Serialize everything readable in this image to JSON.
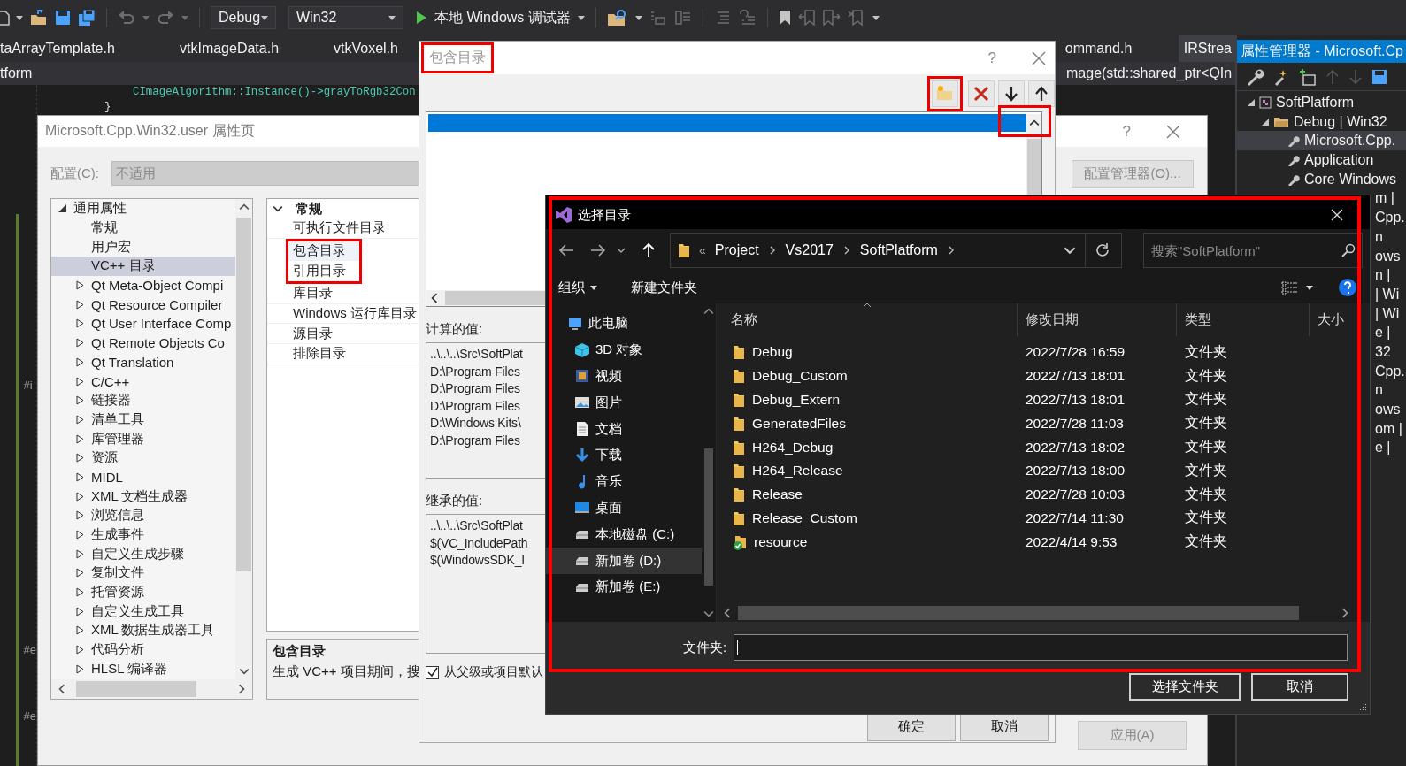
{
  "toolbar": {
    "configuration": "Debug",
    "platform": "Win32",
    "debugger": "本地 Windows 调试器"
  },
  "editor": {
    "tab_groups": [
      {
        "tabs": [
          {
            "label": "taArrayTemplate.h",
            "selected": false
          },
          {
            "label": "vtkImageData.h",
            "selected": false
          },
          {
            "label": "vtkVoxel.h",
            "selected": false
          }
        ]
      },
      {
        "tabs": [
          {
            "label": "ommand.h",
            "selected": false
          },
          {
            "label": "IRStrea",
            "selected": true
          }
        ]
      }
    ],
    "nav_bar": {
      "scope": "tform",
      "member": "mage(std::shared_ptr<QIn"
    },
    "code_lines": [
      "CImageAlgorithm::Instance()->grayToRgb32Con",
      "}"
    ],
    "gutter_marks": [
      "#i",
      "#e",
      "#e"
    ]
  },
  "property_manager": {
    "title": "属性管理器 - Microsoft.Cp",
    "tree": [
      {
        "label": "SoftPlatform",
        "kind": "project",
        "expanded": true,
        "selected": false,
        "children": [
          {
            "label": "Debug | Win32",
            "kind": "config",
            "expanded": true,
            "selected": false,
            "children": [
              {
                "label": "Microsoft.Cpp.",
                "kind": "sheet",
                "selected": true
              },
              {
                "label": "Application",
                "kind": "sheet",
                "selected": false
              },
              {
                "label": "Core Windows",
                "kind": "sheet",
                "selected": false
              }
            ]
          }
        ]
      }
    ],
    "clipped_rows": [
      "m |",
      "Cpp.",
      "n",
      "ows",
      "n |",
      "| Wi",
      "| Wi",
      "e |",
      "32",
      "Cpp.",
      "n",
      "ows",
      "om |",
      "e |"
    ]
  },
  "property_dialog": {
    "title": "Microsoft.Cpp.Win32.user 属性页",
    "help_button": "?",
    "configuration_label": "配置(C):",
    "configuration_value": "不适用",
    "manager_button": "配置管理器(O)...",
    "apply_button": "应用(A)",
    "tree": [
      {
        "label": "通用属性",
        "kind": "folder",
        "expanded": true,
        "selected": false,
        "children": [
          {
            "label": "常规",
            "kind": "leaf",
            "selected": false
          },
          {
            "label": "用户宏",
            "kind": "leaf",
            "selected": false
          },
          {
            "label": "VC++ 目录",
            "kind": "leaf",
            "selected": true
          },
          {
            "label": "Qt Meta-Object Compi",
            "kind": "folder",
            "expanded": false,
            "selected": false
          },
          {
            "label": "Qt Resource Compiler",
            "kind": "folder",
            "expanded": false,
            "selected": false
          },
          {
            "label": "Qt User Interface Comp",
            "kind": "folder",
            "expanded": false,
            "selected": false
          },
          {
            "label": "Qt Remote Objects Co",
            "kind": "folder",
            "expanded": false,
            "selected": false
          },
          {
            "label": "Qt Translation",
            "kind": "folder",
            "expanded": false,
            "selected": false
          },
          {
            "label": "C/C++",
            "kind": "folder",
            "expanded": false,
            "selected": false
          },
          {
            "label": "链接器",
            "kind": "folder",
            "expanded": false,
            "selected": false
          },
          {
            "label": "清单工具",
            "kind": "folder",
            "expanded": false,
            "selected": false
          },
          {
            "label": "库管理器",
            "kind": "folder",
            "expanded": false,
            "selected": false
          },
          {
            "label": "资源",
            "kind": "folder",
            "expanded": false,
            "selected": false
          },
          {
            "label": "MIDL",
            "kind": "folder",
            "expanded": false,
            "selected": false
          },
          {
            "label": "XML 文档生成器",
            "kind": "folder",
            "expanded": false,
            "selected": false
          },
          {
            "label": "浏览信息",
            "kind": "folder",
            "expanded": false,
            "selected": false
          },
          {
            "label": "生成事件",
            "kind": "folder",
            "expanded": false,
            "selected": false
          },
          {
            "label": "自定义生成步骤",
            "kind": "folder",
            "expanded": false,
            "selected": false
          },
          {
            "label": "复制文件",
            "kind": "folder",
            "expanded": false,
            "selected": false
          },
          {
            "label": "托管资源",
            "kind": "folder",
            "expanded": false,
            "selected": false
          },
          {
            "label": "自定义生成工具",
            "kind": "folder",
            "expanded": false,
            "selected": false
          },
          {
            "label": "XML 数据生成器工具",
            "kind": "folder",
            "expanded": false,
            "selected": false
          },
          {
            "label": "代码分析",
            "kind": "folder",
            "expanded": false,
            "selected": false
          },
          {
            "label": "HLSL 编译器",
            "kind": "folder",
            "expanded": false,
            "selected": false
          }
        ]
      }
    ],
    "section": {
      "label": "常规",
      "expanded": true,
      "items": [
        {
          "label": "可执行文件目录",
          "selected": false,
          "highlighted": false
        },
        {
          "label": "包含目录",
          "selected": true,
          "highlighted": true
        },
        {
          "label": "引用目录",
          "selected": false,
          "highlighted": true
        },
        {
          "label": "库目录",
          "selected": false,
          "highlighted": false
        },
        {
          "label": "Windows 运行库目录",
          "selected": false,
          "highlighted": false
        },
        {
          "label": "源目录",
          "selected": false,
          "highlighted": false
        },
        {
          "label": "排除目录",
          "selected": false,
          "highlighted": false
        }
      ]
    },
    "description": {
      "title": "包含目录",
      "text": "生成 VC++ 项目期间，搜"
    }
  },
  "include_dialog": {
    "title": "包含目录",
    "title_highlighted": true,
    "help_button": "?",
    "tools": [
      {
        "kind": "new-folder",
        "highlighted": true
      },
      {
        "kind": "delete",
        "highlighted": false
      },
      {
        "kind": "move-down",
        "highlighted": false
      },
      {
        "kind": "move-up",
        "highlighted": false
      }
    ],
    "rows": [
      {
        "selected": true
      }
    ],
    "scroll_highlighted": true,
    "computed_label": "计算的值:",
    "computed_values": [
      "..\\..\\..\\Src\\SoftPlat",
      "D:\\Program Files",
      "D:\\Program Files",
      "D:\\Program Files",
      "D:\\Windows Kits\\",
      "D:\\Program Files"
    ],
    "inherited_label": "继承的值:",
    "inherited_values": [
      "..\\..\\..\\Src\\SoftPlat",
      "$(VC_IncludePath",
      "$(WindowsSDK_I"
    ],
    "inherit_option": {
      "label": "从父级或项目默认",
      "checked": true
    },
    "buttons": [
      "确定",
      "取消"
    ]
  },
  "folder_dialog": {
    "title": "选择目录",
    "highlighted": true,
    "overflow": "«",
    "path": [
      "Project",
      "Vs2017",
      "SoftPlatform"
    ],
    "search_placeholder": "搜索\"SoftPlatform\"",
    "organize": "组织",
    "new_folder": "新建文件夹",
    "nav_items": [
      {
        "label": "此电脑",
        "kind": "pc",
        "selected": false,
        "children": [
          {
            "label": "3D 对象",
            "kind": "objects",
            "selected": false
          },
          {
            "label": "视频",
            "kind": "videos",
            "selected": false
          },
          {
            "label": "图片",
            "kind": "pictures",
            "selected": false
          },
          {
            "label": "文档",
            "kind": "documents",
            "selected": false
          },
          {
            "label": "下载",
            "kind": "downloads",
            "selected": false
          },
          {
            "label": "音乐",
            "kind": "music",
            "selected": false
          },
          {
            "label": "桌面",
            "kind": "desktop",
            "selected": false
          },
          {
            "label": "本地磁盘 (C:)",
            "kind": "drive",
            "selected": false
          },
          {
            "label": "新加卷 (D:)",
            "kind": "drive",
            "selected": true
          },
          {
            "label": "新加卷 (E:)",
            "kind": "drive",
            "selected": false
          }
        ]
      }
    ],
    "columns": [
      "名称",
      "修改日期",
      "类型",
      "大小"
    ],
    "files": [
      {
        "name": "Debug",
        "kind": "folder",
        "modified": "2022/7/28 16:59",
        "type": "文件夹"
      },
      {
        "name": "Debug_Custom",
        "kind": "folder",
        "modified": "2022/7/13 18:01",
        "type": "文件夹"
      },
      {
        "name": "Debug_Extern",
        "kind": "folder",
        "modified": "2022/7/13 18:01",
        "type": "文件夹"
      },
      {
        "name": "GeneratedFiles",
        "kind": "folder",
        "modified": "2022/7/28 11:03",
        "type": "文件夹"
      },
      {
        "name": "H264_Debug",
        "kind": "folder",
        "modified": "2022/7/13 18:02",
        "type": "文件夹"
      },
      {
        "name": "H264_Release",
        "kind": "folder",
        "modified": "2022/7/13 18:00",
        "type": "文件夹"
      },
      {
        "name": "Release",
        "kind": "folder",
        "modified": "2022/7/28 10:03",
        "type": "文件夹"
      },
      {
        "name": "Release_Custom",
        "kind": "folder",
        "modified": "2022/7/14 11:30",
        "type": "文件夹"
      },
      {
        "name": "resource",
        "kind": "synced",
        "modified": "2022/4/14 9:53",
        "type": "文件夹"
      }
    ],
    "folder_label": "文件夹:",
    "buttons": [
      "选择文件夹",
      "取消"
    ]
  }
}
